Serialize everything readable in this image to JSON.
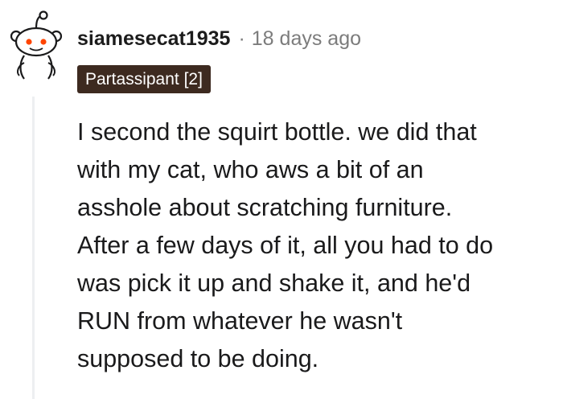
{
  "comment": {
    "username": "siamesecat1935",
    "separator": "·",
    "timestamp": "18 days ago",
    "flair": "Partassipant [2]",
    "body_lines": [
      "I second the squirt bottle. we did that",
      "with my cat, who aws a bit of an",
      "asshole about scratching furniture.",
      "After a few days of it, all you had to do",
      "was pick it up and shake it, and he'd",
      "RUN from whatever he wasn't",
      "supposed to be doing."
    ]
  },
  "icons": {
    "avatar": "snoo-avatar-icon"
  },
  "colors": {
    "flair_background": "#3d2a20",
    "flair_text": "#ffffff",
    "username": "#1c1c1c",
    "meta": "#7c7c7c",
    "body": "#1a1a1b",
    "thread_line": "#edeff1",
    "snoo_eye": "#ff4500"
  }
}
